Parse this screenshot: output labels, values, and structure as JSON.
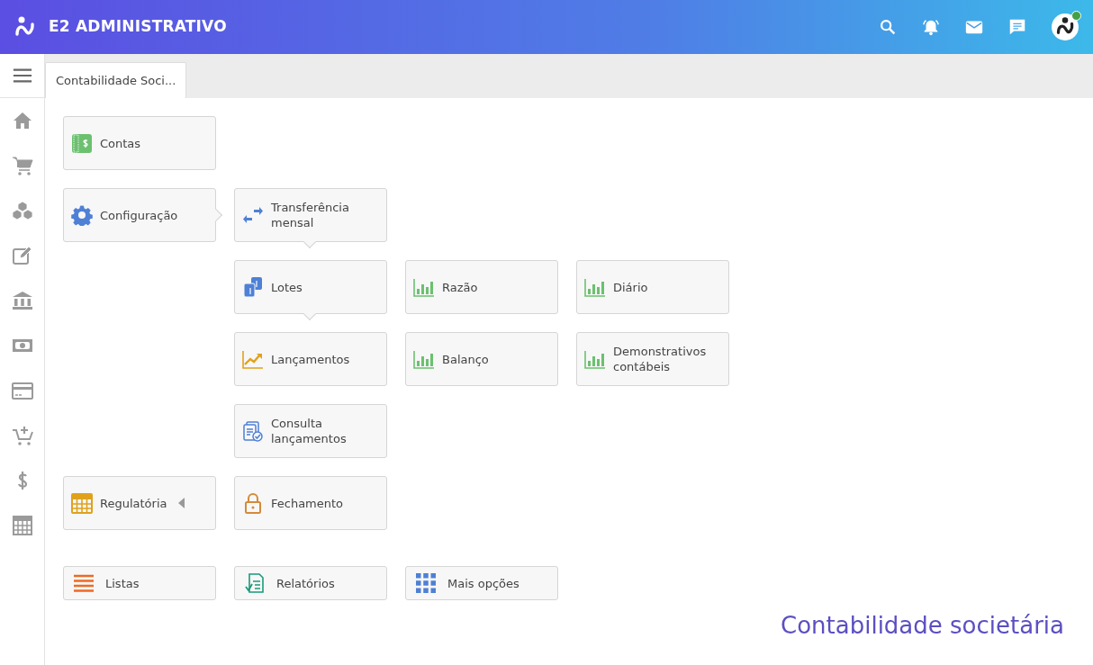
{
  "app": {
    "title": "E2 ADMINISTRATIVO"
  },
  "user": {
    "online": true
  },
  "tabs": [
    {
      "label": "Contabilidade Soci...",
      "selected": true
    }
  ],
  "menu_rows": [
    {
      "cells": [
        {
          "label": "Contas",
          "kind": "ledger",
          "expanded": false,
          "submenu": false
        }
      ]
    },
    {
      "cells": [
        {
          "label": "Configuração",
          "kind": "gear",
          "expanded": true,
          "submenu": false
        },
        {
          "label": "Transferência mensal",
          "kind": "transfer",
          "expanded": true,
          "submenu": false
        }
      ]
    },
    {
      "cells": [
        null,
        {
          "label": "Lotes",
          "kind": "batches",
          "expanded": true,
          "submenu": false
        },
        {
          "label": "Razão",
          "kind": "bars",
          "expanded": false,
          "submenu": false
        },
        {
          "label": "Diário",
          "kind": "bars",
          "expanded": false,
          "submenu": false
        }
      ]
    },
    {
      "cells": [
        null,
        {
          "label": "Lançamentos",
          "kind": "trend",
          "expanded": false,
          "submenu": false
        },
        {
          "label": "Balanço",
          "kind": "bars",
          "expanded": false,
          "submenu": false
        },
        {
          "label": "Demonstrativos contábeis",
          "kind": "bars",
          "expanded": false,
          "submenu": false
        }
      ]
    },
    {
      "cells": [
        null,
        {
          "label": "Consulta lançamentos",
          "kind": "doccheck",
          "expanded": false,
          "submenu": false
        }
      ]
    },
    {
      "cells": [
        {
          "label": "Regulatória",
          "kind": "calc",
          "expanded": false,
          "submenu": true
        },
        {
          "label": "Fechamento",
          "kind": "lock",
          "expanded": false,
          "submenu": false
        }
      ]
    }
  ],
  "footer_tiles": [
    {
      "label": "Listas",
      "kind": "list"
    },
    {
      "label": "Relatórios",
      "kind": "report"
    },
    {
      "label": "Mais opções",
      "kind": "apps"
    }
  ],
  "page_title": "Contabilidade societária"
}
